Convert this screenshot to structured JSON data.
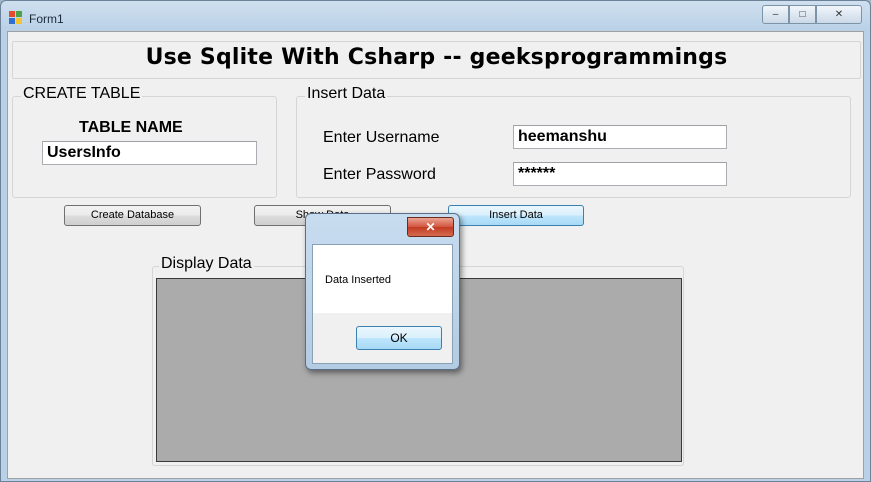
{
  "window": {
    "title": "Form1",
    "minimize": "–",
    "maximize": "□",
    "close": "✕"
  },
  "header": {
    "title": "Use Sqlite With Csharp -- geeksprogrammings"
  },
  "create_table": {
    "legend": "CREATE TABLE",
    "label": "TABLE NAME",
    "value": "UsersInfo"
  },
  "insert_data": {
    "legend": "Insert Data",
    "username_label": "Enter Username",
    "username_value": "heemanshu",
    "password_label": "Enter Password",
    "password_value": "******"
  },
  "buttons": {
    "create_db": "Create Database",
    "show_data": "Show Data",
    "insert_data": "Insert Data"
  },
  "display": {
    "legend": "Display Data"
  },
  "dialog": {
    "message": "Data Inserted",
    "ok": "OK",
    "close": "✕"
  },
  "colors": {
    "accent": "#3c7fb1",
    "close": "#c23b23"
  }
}
